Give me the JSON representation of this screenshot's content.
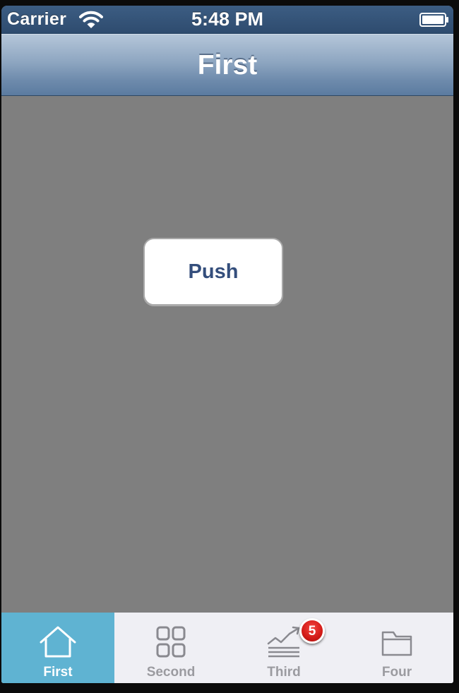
{
  "status_bar": {
    "carrier": "Carrier",
    "time": "5:48 PM",
    "wifi_icon": "wifi-icon",
    "battery_icon": "battery-icon"
  },
  "nav_bar": {
    "title": "First"
  },
  "content": {
    "push_button_label": "Push",
    "background_color": "#7f7f7f"
  },
  "tab_bar": {
    "selected_index": 0,
    "accent_color": "#5fb3d2",
    "tabs": [
      {
        "label": "First",
        "icon": "home-icon"
      },
      {
        "label": "Second",
        "icon": "grid-icon"
      },
      {
        "label": "Third",
        "icon": "chart-icon"
      },
      {
        "label": "Four",
        "icon": "folder-icon",
        "badge": "5"
      }
    ]
  }
}
